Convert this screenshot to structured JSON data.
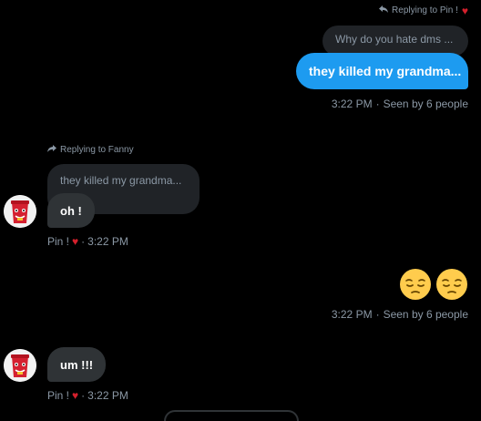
{
  "colors": {
    "background": "#000000",
    "outgoing_bubble": "#1d9bf0",
    "incoming_bubble": "#2f3336",
    "quoted_bubble": "#202327",
    "muted_text": "#8b98a5",
    "heart": "#d4202c"
  },
  "messages": {
    "outgoing_1": {
      "reply_header": "Replying to Pin !",
      "reply_icon": "reply-arrow-icon",
      "heart_icon": "heart-icon",
      "quoted_text": "Why do you hate dms ...",
      "text": "they killed my grandma...",
      "time": "3:22 PM",
      "separator": "·",
      "seen": "Seen by 6 people"
    },
    "incoming_1": {
      "reply_header": "Replying to Fanny",
      "reply_icon": "reply-arrow-icon",
      "quoted_text": "they killed my grandma...",
      "text": "oh !",
      "sender": "Pin !",
      "heart_icon": "heart-icon",
      "separator": "·",
      "time": "3:22 PM",
      "avatar_icon": "red-cup-avatar"
    },
    "outgoing_2": {
      "emojis": [
        "pensive-face-emoji",
        "pensive-face-emoji"
      ],
      "time": "3:22 PM",
      "separator": "·",
      "seen": "Seen by 6 people"
    },
    "incoming_2": {
      "text": "um !!!",
      "sender": "Pin !",
      "heart_icon": "heart-icon",
      "separator": "·",
      "time": "3:22 PM",
      "avatar_icon": "red-cup-avatar"
    }
  }
}
